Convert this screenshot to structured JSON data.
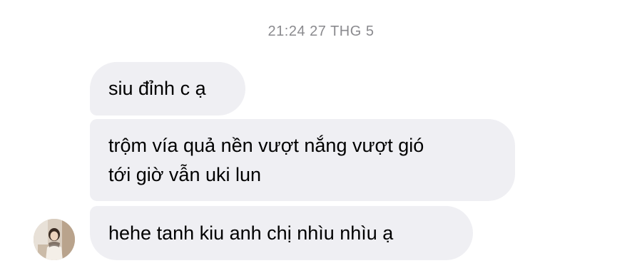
{
  "timestamp": "21:24 27 THG 5",
  "messages": [
    {
      "lines": [
        "siu đỉnh c ạ"
      ]
    },
    {
      "lines": [
        "trộm vía quả nền vượt nắng vượt gió",
        "tới giờ vẫn uki lun"
      ]
    },
    {
      "lines": [
        "hehe tanh kiu anh chị nhìu nhìu ạ"
      ]
    }
  ],
  "colors": {
    "bubble_background": "#efeff3",
    "timestamp_text": "#8a8a8e",
    "message_text": "#000000"
  },
  "icons": {
    "sender_avatar": "avatar-photo"
  }
}
